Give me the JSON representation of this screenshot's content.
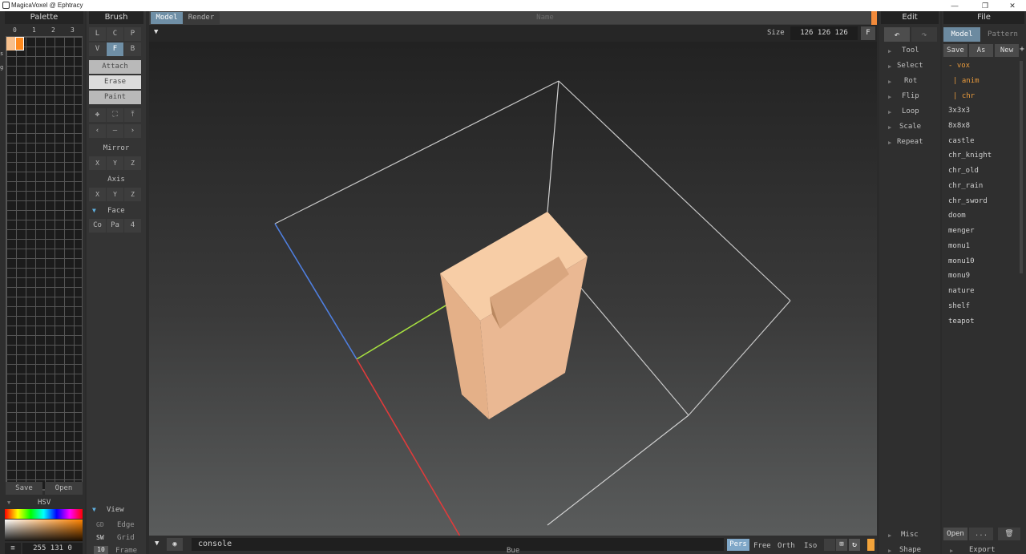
{
  "window": {
    "title": "MagicaVoxel @ Ephtracy",
    "controls": [
      "—",
      "❐",
      "✕"
    ]
  },
  "palette": {
    "title": "Palette",
    "tabs": [
      "0",
      "1",
      "2",
      "3"
    ],
    "side_marks": [
      "s",
      "g"
    ],
    "swatches": [
      "#f7c08d",
      "#ff8a1e"
    ],
    "save_label": "Save",
    "open_label": "Open",
    "hsv_label": "HSV",
    "rgb_value": "255 131 0",
    "menu_glyph": "≡"
  },
  "brush": {
    "title": "Brush",
    "row1": [
      "L",
      "C",
      "P"
    ],
    "row2": [
      "V",
      "F",
      "B"
    ],
    "modes": [
      "Attach",
      "Erase",
      "Paint"
    ],
    "tools": [
      "✥",
      "⛶",
      "⤒"
    ],
    "nav": [
      "‹",
      "—",
      "›"
    ],
    "mirror_label": "Mirror",
    "mirror_axes": [
      "X",
      "Y",
      "Z"
    ],
    "axis_label": "Axis",
    "axis_axes": [
      "X",
      "Y",
      "Z"
    ],
    "face_label": "Face",
    "face_options": [
      "Co",
      "Pa",
      "4"
    ],
    "view_label": "View",
    "view_rows": [
      {
        "key": "GD",
        "label": "Edge"
      },
      {
        "key": "SW",
        "label": "Grid"
      },
      {
        "key": "10",
        "label": "Frame"
      }
    ]
  },
  "viewport": {
    "tabs": [
      "Model",
      "Render"
    ],
    "name_placeholder": "Name",
    "size_label": "Size",
    "size_value": "126 126 126",
    "fit_label": "F",
    "console_value": "console",
    "modes": [
      "Pers",
      "Free",
      "Orth",
      "Iso"
    ],
    "status": "Bue",
    "accent": "#f28a3a",
    "voxel_color": "#f4c29a"
  },
  "edit": {
    "title": "Edit",
    "undo_glyph": "↶",
    "redo_glyph": "↷",
    "items": [
      "Tool",
      "Select",
      "Rot",
      "Flip",
      "Loop",
      "Scale",
      "Repeat"
    ],
    "bottom_items": [
      "Misc",
      "Shape"
    ]
  },
  "file": {
    "title": "File",
    "tabs": [
      "Model",
      "Pattern"
    ],
    "actions": [
      "Save",
      "As",
      "New"
    ],
    "plus": "+",
    "folders": [
      "- vox",
      "| anim",
      "| chr"
    ],
    "files": [
      "3x3x3",
      "8x8x8",
      "castle",
      "chr_knight",
      "chr_old",
      "chr_rain",
      "chr_sword",
      "doom",
      "menger",
      "monu1",
      "monu10",
      "monu9",
      "nature",
      "shelf",
      "teapot"
    ],
    "open_label": "Open",
    "more_label": "...",
    "trash_glyph": "🗑",
    "export_label": "Export"
  }
}
